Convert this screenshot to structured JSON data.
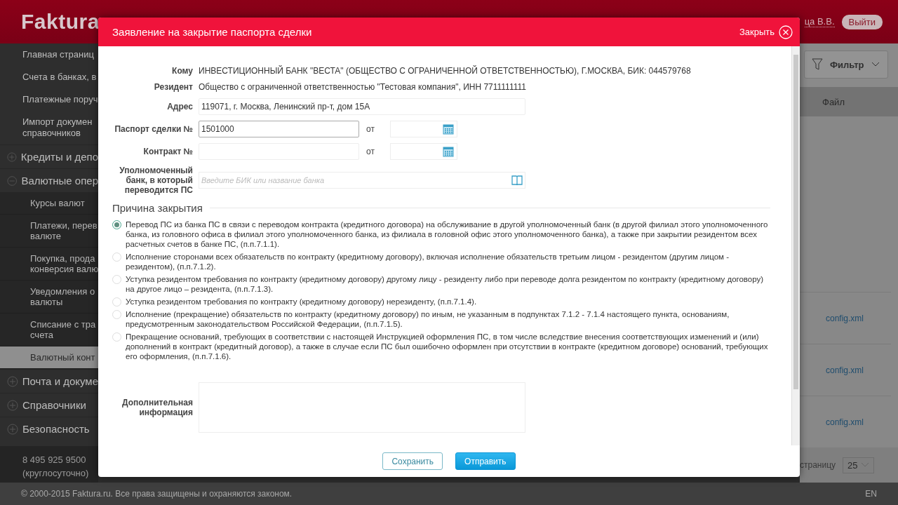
{
  "app": {
    "logo": "Faktura",
    "user": "ца В.В.",
    "logout": "Выйти"
  },
  "sidebar": {
    "items": [
      {
        "kind": "link",
        "label": "Главная страниц",
        "selected": false
      },
      {
        "kind": "link",
        "label": "Счета в банках, в",
        "selected": false
      },
      {
        "kind": "link",
        "label": "Платежные поруч",
        "selected": false
      },
      {
        "kind": "link",
        "label": "Импорт докумен\nсправочников",
        "selected": false
      },
      {
        "kind": "group",
        "label": "Кредиты и депо",
        "expanded": false
      },
      {
        "kind": "group",
        "label": "Валютные опер",
        "expanded": true,
        "children": [
          {
            "label": "Курсы валют",
            "selected": false
          },
          {
            "label": "Платежи, перев\nвалюте",
            "selected": false
          },
          {
            "label": "Покупка, прода\nконверсия валю",
            "selected": false
          },
          {
            "label": "Уведомления о\nвалюты",
            "selected": false
          },
          {
            "label": "Списание с тра\nсчета",
            "selected": false
          },
          {
            "label": "Валютный конт",
            "selected": true
          }
        ]
      },
      {
        "kind": "group",
        "label": "Почта и докуме",
        "expanded": false
      },
      {
        "kind": "group",
        "label": "Справочники",
        "expanded": false
      },
      {
        "kind": "group",
        "label": "Безопасность",
        "expanded": false
      }
    ],
    "phone": "8 495 925 9500",
    "phone_note": "(круглосуточно)"
  },
  "content": {
    "filter": "Фильтр",
    "column": "Файл",
    "files": [
      "config.xml",
      "config.xml",
      "config.xml"
    ],
    "per_page_label": "страницу",
    "per_page": "25"
  },
  "footer": {
    "copyright": "© 2000-2015 Faktura.ru. Все права защищены и охраняются законом.",
    "language": "EN"
  },
  "dialog": {
    "title": "Заявление на закрытие паспорта сделки",
    "close": "Закрыть",
    "fields": [
      {
        "kind": "text",
        "label": "Кому",
        "value": "ИНВЕСТИЦИОННЫЙ БАНК \"ВЕСТА\" (ОБЩЕСТВО С ОГРАНИЧЕННОЙ ОТВЕТСТВЕННОСТЬЮ), Г.МОСКВА, БИК: 044579768"
      },
      {
        "kind": "text",
        "label": "Резидент",
        "value": "Общество с ограниченной ответственностью \"Тестовая компания\", ИНН 7711111111"
      },
      {
        "kind": "input",
        "label": "Адрес",
        "value": "119071, г. Москва, Ленинский пр-т, дом 15А"
      },
      {
        "kind": "numbered",
        "label": "Паспорт сделки №",
        "value": "1501000",
        "date_label": "от",
        "focused": true
      },
      {
        "kind": "numbered",
        "label": "Контракт №",
        "date_label": "от",
        "focused": false
      },
      {
        "kind": "lookup",
        "label": "Уполномоченный банк, в который переводится ПС",
        "placeholder": "Введите БИК или название банка"
      }
    ],
    "reason": {
      "title": "Причина закрытия",
      "options": [
        {
          "label": "Перевод ПС из банка ПС в связи с переводом контракта (кредитного договора) на обслуживание в другой уполномоченный банк (в другой филиал этого уполномоченного банка, из головного офиса в филиал этого уполномоченного банка, из филиала в головной офис этого уполномоченного банка), а также при закрытии резидентом всех расчетных счетов в банке ПС, (п.п.7.1.1).",
          "selected": true
        },
        {
          "label": "Исполнение сторонами всех обязательств по контракту (кредитному договору), включая исполнение обязательств третьим лицом - резидентом (другим лицом - резидентом), (п.п.7.1.2).",
          "selected": false
        },
        {
          "label": "Уступка резидентом требования по контракту (кредитному договору) другому лицу - резиденту либо при переводе долга резидентом по контракту (кредитному договору) на другое лицо – резидента, (п.п.7.1.3).",
          "selected": false
        },
        {
          "label": "Уступка резидентом требования по контракту (кредитному договору) нерезиденту, (п.п.7.1.4).",
          "selected": false
        },
        {
          "label": "Исполнение (прекращение) обязательств по контракту (кредитному договору) по иным, не указанным в подпунктах 7.1.2 - 7.1.4 настоящего пункта, основаниям, предусмотренным законодательством Российской Федерации, (п.п.7.1.5).",
          "selected": false
        },
        {
          "label": "Прекращение оснований, требующих в соответствии с настоящей Инструкцией оформления ПС, в том числе вследствие внесения соответствующих изменений и (или) дополнений в контракт (кредитный договор), а также в случае если ПС был ошибочно оформлен при отсутствии в контракте (кредитном договоре) оснований, требующих его оформления, (п.п.7.1.6).",
          "selected": false
        }
      ]
    },
    "extra": {
      "label": "Дополнительная информация"
    },
    "buttons": [
      {
        "kind": "secondary",
        "label": "Сохранить"
      },
      {
        "kind": "primary",
        "label": "Отправить"
      }
    ]
  }
}
